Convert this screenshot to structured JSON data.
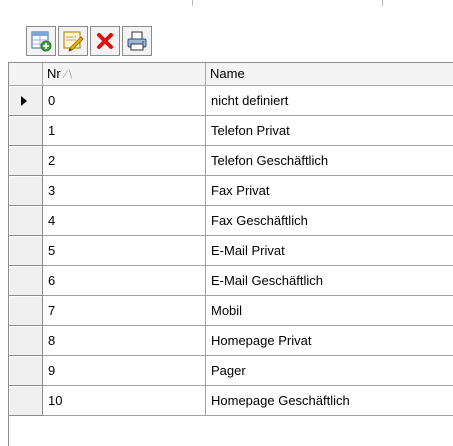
{
  "toolbar": {
    "buttons": [
      {
        "icon": "add-record-icon"
      },
      {
        "icon": "edit-record-icon"
      },
      {
        "icon": "delete-icon"
      },
      {
        "icon": "print-icon"
      }
    ]
  },
  "grid": {
    "columns": [
      {
        "label": "Nr",
        "sort_indicator": "∕∖"
      },
      {
        "label": "Name"
      }
    ],
    "current_row_index": 0,
    "rows": [
      {
        "nr": "0",
        "name": "nicht definiert"
      },
      {
        "nr": "1",
        "name": "Telefon Privat"
      },
      {
        "nr": "2",
        "name": "Telefon Geschäftlich"
      },
      {
        "nr": "3",
        "name": "Fax Privat"
      },
      {
        "nr": "4",
        "name": "Fax Geschäftlich"
      },
      {
        "nr": "5",
        "name": "E-Mail Privat"
      },
      {
        "nr": "6",
        "name": "E-Mail Geschäftlich"
      },
      {
        "nr": "7",
        "name": "Mobil"
      },
      {
        "nr": "8",
        "name": "Homepage Privat"
      },
      {
        "nr": "9",
        "name": "Pager"
      },
      {
        "nr": "10",
        "name": "Homepage Geschäftlich"
      }
    ]
  },
  "colors": {
    "delete_red": "#e01010",
    "header_bg": "#f4f4f4",
    "grid_line": "#a0a0a0"
  }
}
